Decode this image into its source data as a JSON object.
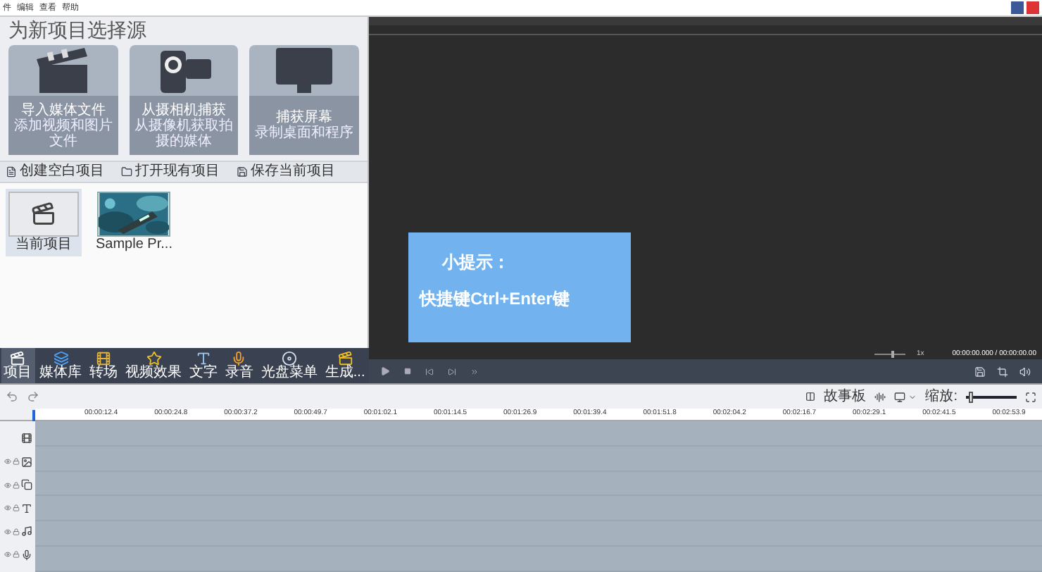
{
  "menu": [
    "件",
    "编辑",
    "查看",
    "帮助"
  ],
  "panel_title": "为新项目选择源",
  "source_cards": [
    {
      "kind": "clapper",
      "label": "导入媒体文件",
      "hint": "添加视频和图片文件"
    },
    {
      "kind": "camera",
      "label": "从摄相机捕获",
      "hint": "从摄像机获取拍摄的媒体"
    },
    {
      "kind": "screen",
      "label": "捕获屏幕",
      "hint": "录制桌面和程序"
    }
  ],
  "project_actions": [
    {
      "kind": "new",
      "label": "创建空白项目"
    },
    {
      "kind": "open",
      "label": "打开现有项目"
    },
    {
      "kind": "save",
      "label": "保存当前项目"
    }
  ],
  "projects": [
    {
      "kind": "current",
      "label": "当前项目",
      "selected": true
    },
    {
      "kind": "picture",
      "label": "Sample Pr...",
      "selected": false
    }
  ],
  "toolbar": [
    {
      "kind": "project",
      "label": "项目",
      "selected": true
    },
    {
      "kind": "library",
      "label": "媒体库",
      "selected": false
    },
    {
      "kind": "transition",
      "label": "转场",
      "selected": false
    },
    {
      "kind": "effects",
      "label": "视频效果",
      "selected": false
    },
    {
      "kind": "text",
      "label": "文字",
      "selected": false
    },
    {
      "kind": "record",
      "label": "录音",
      "selected": false
    },
    {
      "kind": "disc",
      "label": "光盘菜单",
      "selected": false
    },
    {
      "kind": "produce",
      "label": "生成...",
      "selected": false
    }
  ],
  "tip": {
    "title": "小提示：",
    "body": "快捷键Ctrl+Enter键"
  },
  "preview": {
    "speed": "1x",
    "speed_slider": {
      "level": 0.6
    },
    "time": "00:00:00.000 / 00:00:00.00"
  },
  "timeline": {
    "storyboard": "故事板",
    "zoom_label": "缩放:",
    "zoom_slider": {
      "level": 0.05
    },
    "ticks": [
      "00:00:12.4",
      "00:00:24.8",
      "00:00:37.2",
      "00:00:49.7",
      "00:01:02.1",
      "00:01:14.5",
      "00:01:26.9",
      "00:01:39.4",
      "00:01:51.8",
      "00:02:04.2",
      "00:02:16.7",
      "00:02:29.1",
      "00:02:41.5",
      "00:02:53.9"
    ],
    "tracks": [
      {
        "kind": "video"
      },
      {
        "kind": "overlay"
      },
      {
        "kind": "effects"
      },
      {
        "kind": "text"
      },
      {
        "kind": "music"
      },
      {
        "kind": "voice"
      }
    ]
  }
}
